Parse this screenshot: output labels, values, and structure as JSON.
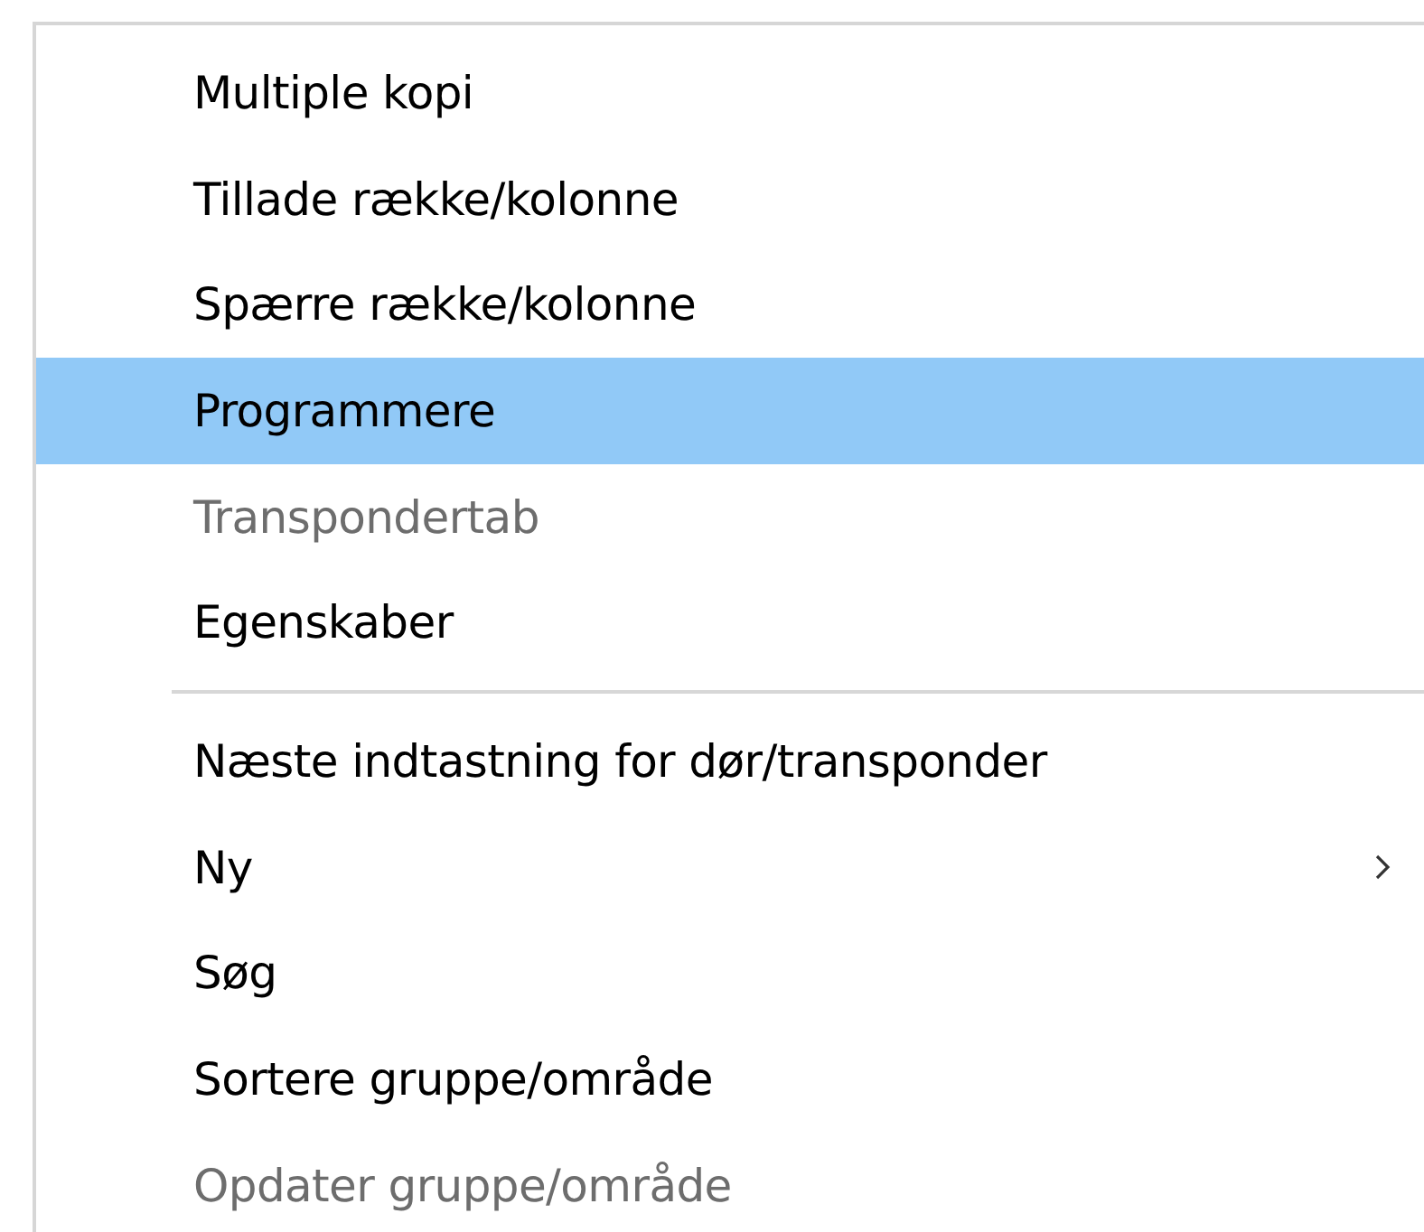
{
  "menu": {
    "items": [
      {
        "kind": "item",
        "label": "Multiple kopi",
        "selected": false,
        "disabled": false,
        "submenu": false
      },
      {
        "kind": "item",
        "label": "Tillade række/kolonne",
        "selected": false,
        "disabled": false,
        "submenu": false
      },
      {
        "kind": "item",
        "label": "Spærre række/kolonne",
        "selected": false,
        "disabled": false,
        "submenu": false
      },
      {
        "kind": "item",
        "label": "Programmere",
        "selected": true,
        "disabled": false,
        "submenu": false
      },
      {
        "kind": "item",
        "label": "Transpondertab",
        "selected": false,
        "disabled": true,
        "submenu": false
      },
      {
        "kind": "item",
        "label": "Egenskaber",
        "selected": false,
        "disabled": false,
        "submenu": false
      },
      {
        "kind": "separator"
      },
      {
        "kind": "item",
        "label": "Næste indtastning for dør/transponder",
        "selected": false,
        "disabled": false,
        "submenu": false
      },
      {
        "kind": "item",
        "label": "Ny",
        "selected": false,
        "disabled": false,
        "submenu": true
      },
      {
        "kind": "item",
        "label": "Søg",
        "selected": false,
        "disabled": false,
        "submenu": false
      },
      {
        "kind": "item",
        "label": "Sortere gruppe/område",
        "selected": false,
        "disabled": false,
        "submenu": false
      },
      {
        "kind": "item",
        "label": "Opdater gruppe/område",
        "selected": false,
        "disabled": true,
        "submenu": false
      }
    ]
  }
}
